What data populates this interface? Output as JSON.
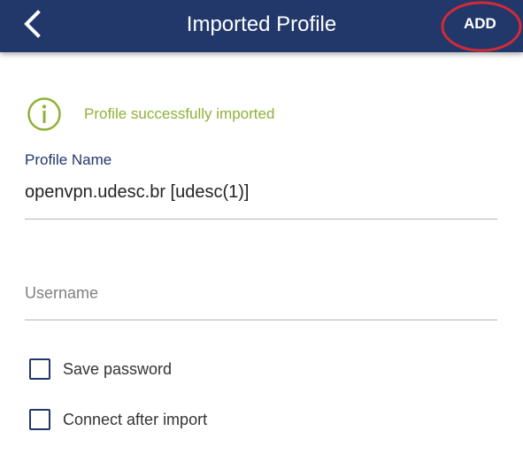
{
  "header": {
    "title": "Imported Profile",
    "back_icon": "chevron-left-icon",
    "add_label": "ADD",
    "background": "#22386b"
  },
  "status": {
    "icon": "info-circle-icon",
    "message": "Profile successfully imported",
    "color": "#8fb136"
  },
  "profile_name": {
    "label": "Profile Name",
    "value": "openvpn.udesc.br [udesc(1)]"
  },
  "username": {
    "placeholder": "Username",
    "value": ""
  },
  "options": [
    {
      "label": "Save password",
      "checked": false
    },
    {
      "label": "Connect after import",
      "checked": false
    }
  ],
  "annotation": {
    "shape": "ellipse",
    "color": "#d42a35",
    "target": "ADD"
  }
}
